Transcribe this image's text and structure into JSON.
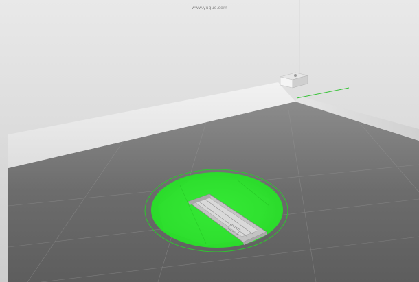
{
  "watermark": "www.yuque.com",
  "colors": {
    "sky_top": "#e8e8e8",
    "sky_bottom": "#cfcfcf",
    "floor_near": "#5c5c5c",
    "floor_far": "#8a8a8a",
    "wall": "#e9e9e9",
    "base_fill": "#33ee33",
    "base_edge": "#22cc22",
    "axis_green": "#39c339",
    "model_fill": "#c9c9c9"
  },
  "icons": {
    "model": "phone-stand-model-icon",
    "base": "brim-disc-icon",
    "origin": "origin-cube-icon"
  }
}
